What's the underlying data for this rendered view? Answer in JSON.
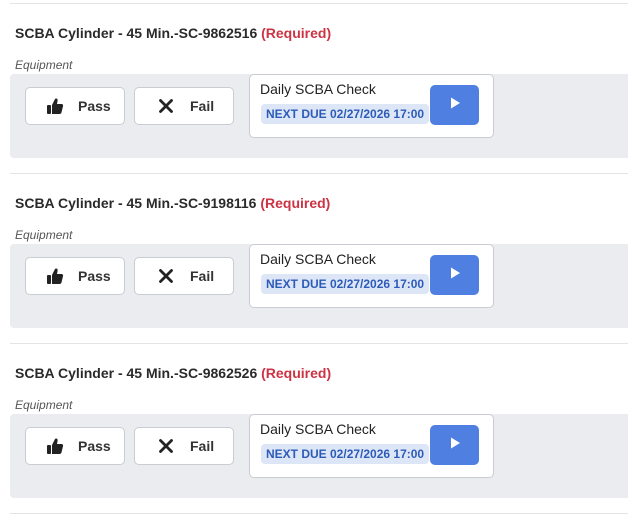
{
  "items": [
    {
      "title": "SCBA Cylinder - 45 Min.-SC-9862516",
      "required_label": "(Required)",
      "category": "Equipment",
      "pass_label": "Pass",
      "fail_label": "Fail",
      "check_name": "Daily SCBA Check",
      "next_due": "NEXT DUE 02/27/2026 17:00",
      "pass_icon": "thumbs-up-icon",
      "fail_icon": "x-icon",
      "play_icon": "play-icon"
    },
    {
      "title": "SCBA Cylinder - 45 Min.-SC-9198116",
      "required_label": "(Required)",
      "category": "Equipment",
      "pass_label": "Pass",
      "fail_label": "Fail",
      "check_name": "Daily SCBA Check",
      "next_due": "NEXT DUE 02/27/2026 17:00",
      "pass_icon": "thumbs-up-icon",
      "fail_icon": "x-icon",
      "play_icon": "play-icon"
    },
    {
      "title": "SCBA Cylinder - 45 Min.-SC-9862526",
      "required_label": "(Required)",
      "category": "Equipment",
      "pass_label": "Pass",
      "fail_label": "Fail",
      "check_name": "Daily SCBA Check",
      "next_due": "NEXT DUE 02/27/2026 17:00",
      "pass_icon": "thumbs-up-icon",
      "fail_icon": "x-icon",
      "play_icon": "play-icon"
    }
  ],
  "colors": {
    "required": "#cc3344",
    "play_button": "#4f7fe0",
    "due_badge_bg": "#dde6f7",
    "due_badge_text": "#2d5bb8",
    "panel_bg": "#ebecef"
  }
}
